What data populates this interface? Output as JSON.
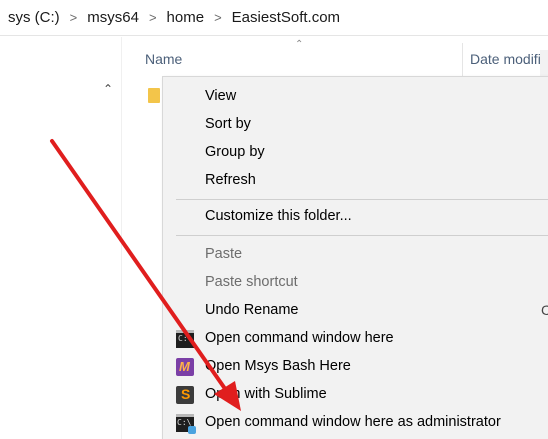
{
  "breadcrumb": {
    "items": [
      "sys (C:)",
      "msys64",
      "home",
      "EasiestSoft.com"
    ],
    "separator": ">"
  },
  "columns": {
    "name": "Name",
    "date": "Date modifi"
  },
  "menu": {
    "items": [
      {
        "label": "View"
      },
      {
        "label": "Sort by"
      },
      {
        "label": "Group by"
      },
      {
        "label": "Refresh"
      },
      {
        "label": "Customize this folder..."
      },
      {
        "label": "Paste"
      },
      {
        "label": "Paste shortcut"
      },
      {
        "label": "Undo Rename",
        "shortcut": "C"
      },
      {
        "label": "Open command window here",
        "icon": "cmd-icon"
      },
      {
        "label": "Open Msys Bash Here",
        "icon": "msys-icon"
      },
      {
        "label": "Open with Sublime",
        "icon": "sublime-icon"
      },
      {
        "label": "Open command window here as administrator",
        "icon": "admin-cmd-icon"
      }
    ]
  },
  "annotation": {
    "arrow_color": "#e01e1e"
  },
  "colors": {
    "header_text": "#4c607a",
    "menu_bg": "#f2f2f2",
    "folder": "#f3c54a"
  }
}
